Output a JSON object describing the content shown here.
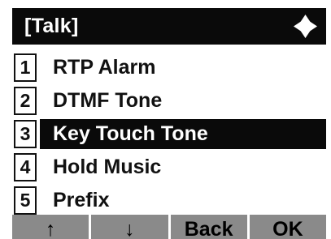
{
  "title": "[Talk]",
  "nav_icon": "four-way-navigation-icon",
  "menu": [
    {
      "num": "1",
      "label": "RTP Alarm",
      "selected": false
    },
    {
      "num": "2",
      "label": "DTMF Tone",
      "selected": false
    },
    {
      "num": "3",
      "label": "Key Touch Tone",
      "selected": true
    },
    {
      "num": "4",
      "label": "Hold Music",
      "selected": false
    },
    {
      "num": "5",
      "label": "Prefix",
      "selected": false
    }
  ],
  "softkeys": {
    "up": "↑",
    "down": "↓",
    "back": "Back",
    "ok": "OK"
  },
  "colors": {
    "title_bg": "#0a0a0a",
    "highlight_bg": "#0a0a0a",
    "softkey_bg": "#8a8a8a"
  }
}
